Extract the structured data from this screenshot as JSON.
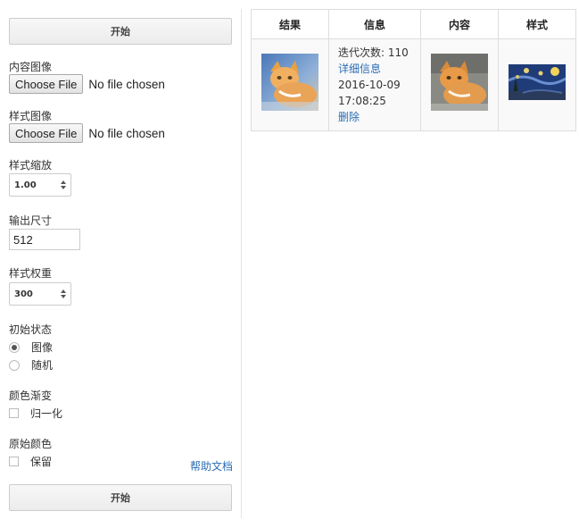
{
  "form": {
    "start_button_label": "开始",
    "content_image_label": "内容图像",
    "style_image_label": "样式图像",
    "choose_file_label": "Choose File",
    "no_file_text": "No file chosen",
    "style_scale_label": "样式缩放",
    "style_scale_value": "1.00",
    "output_size_label": "输出尺寸",
    "output_size_value": "512",
    "style_weight_label": "样式权重",
    "style_weight_value": "300",
    "init_state_label": "初始状态",
    "init_state_options": [
      "图像",
      "随机"
    ],
    "init_state_selected": "图像",
    "color_gradient_label": "颜色渐变",
    "normalize_label": "归一化",
    "normalize_checked": false,
    "original_color_label": "原始颜色",
    "preserve_label": "保留",
    "preserve_checked": false,
    "help_link": "帮助文档"
  },
  "results": {
    "headers": [
      "结果",
      "信息",
      "内容",
      "样式"
    ],
    "rows": [
      {
        "iterations": "迭代次数: 110",
        "details_link": "详细信息",
        "date": "2016-10-09",
        "time": "17:08:25",
        "delete_link": "删除"
      }
    ]
  },
  "colors": {
    "link": "#2a6db5",
    "border": "#dddddd"
  }
}
